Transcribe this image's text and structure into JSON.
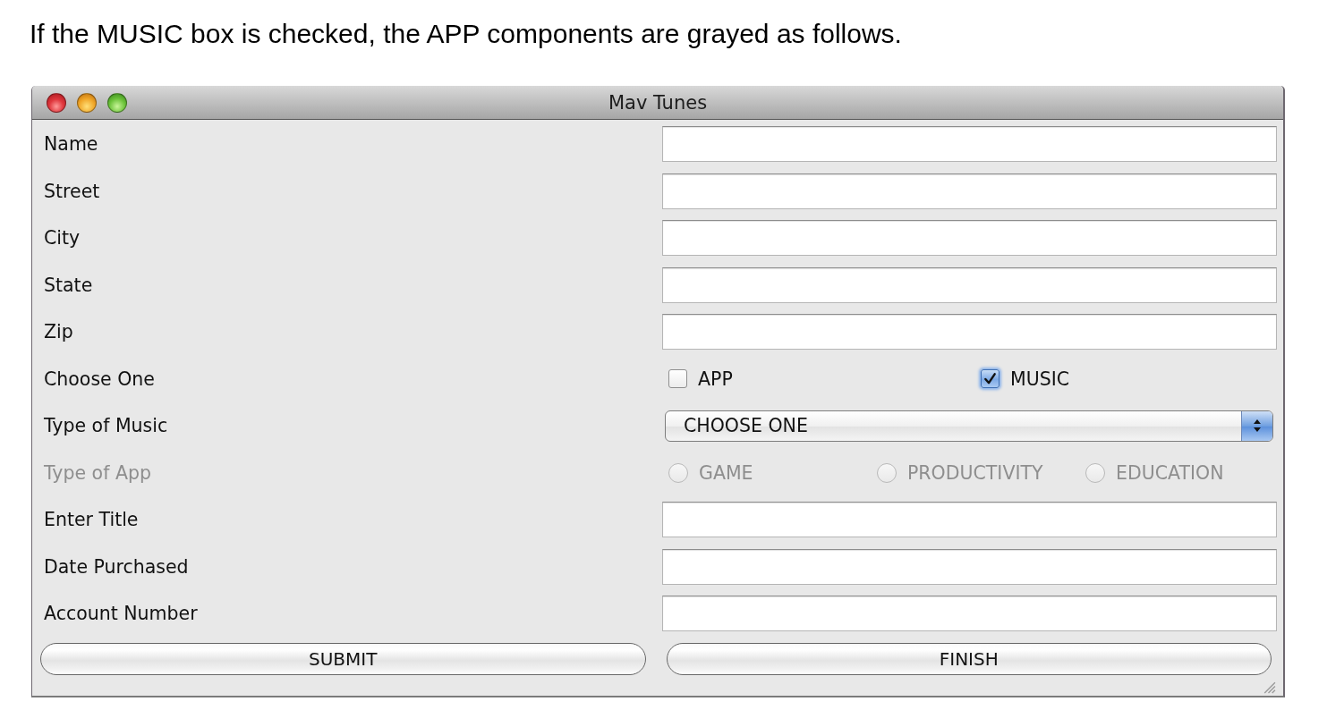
{
  "caption": "If the MUSIC box is checked, the APP components are grayed as follows.",
  "window": {
    "title": "Mav Tunes"
  },
  "form": {
    "rows": [
      {
        "kind": "text",
        "label": "Name",
        "disabled": false
      },
      {
        "kind": "text",
        "label": "Street",
        "disabled": false
      },
      {
        "kind": "text",
        "label": "City",
        "disabled": false
      },
      {
        "kind": "text",
        "label": "State",
        "disabled": false
      },
      {
        "kind": "text",
        "label": "Zip",
        "disabled": false
      },
      {
        "kind": "checkboxes",
        "label": "Choose One",
        "disabled": false,
        "options": [
          {
            "label": "APP",
            "checked": false
          },
          {
            "label": "MUSIC",
            "checked": true
          }
        ]
      },
      {
        "kind": "dropdown",
        "label": "Type of Music",
        "disabled": false,
        "value": "CHOOSE ONE"
      },
      {
        "kind": "radios",
        "label": "Type of App",
        "disabled": true,
        "options": [
          {
            "label": "GAME",
            "selected": false
          },
          {
            "label": "PRODUCTIVITY",
            "selected": false
          },
          {
            "label": "EDUCATION",
            "selected": false
          }
        ]
      },
      {
        "kind": "text",
        "label": "Enter Title",
        "disabled": false
      },
      {
        "kind": "text",
        "label": "Date Purchased",
        "disabled": false
      },
      {
        "kind": "text",
        "label": "Account Number",
        "disabled": false
      }
    ]
  },
  "buttons": [
    {
      "label": "SUBMIT"
    },
    {
      "label": "FINISH"
    }
  ]
}
